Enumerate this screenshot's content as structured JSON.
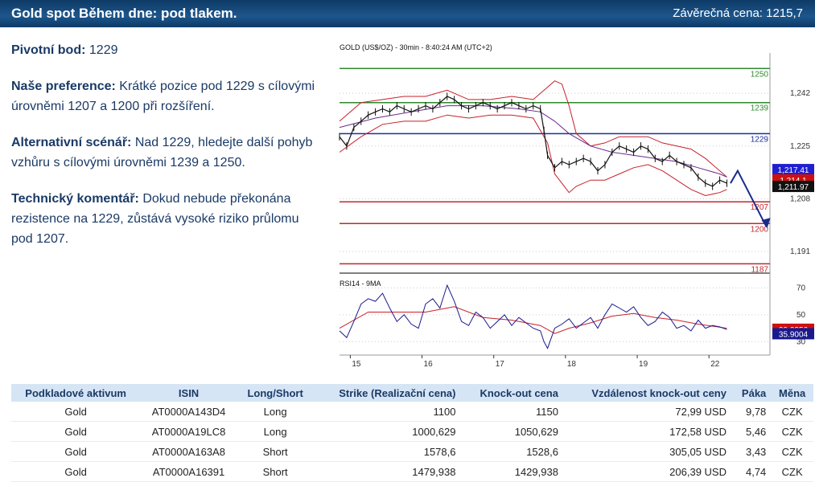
{
  "header": {
    "title": "Gold spot Během dne: pod tlakem.",
    "close_label": "Závěrečná cena: 1215,7"
  },
  "commentary": {
    "pivot_label": "Pivotní bod:",
    "pivot_value": "1229",
    "pref_label": "Naše preference:",
    "pref_text": "Krátké pozice pod 1229 s cílovými úrovněmi 1207 a 1200 při  rozšíření.",
    "alt_label": "Alternativní scénář:",
    "alt_text": "Nad 1229, hledejte další pohyb vzhůru s cílovými úrovněmi 1239 a 1250.",
    "tech_label": "Technický komentář:",
    "tech_text": "Dokud nebude překonána rezistence na 1229, zůstává vysoké riziko průlomu pod 1207."
  },
  "chart_data": {
    "type": "line",
    "title": "GOLD (US$/OZ) - 30min - 8:40:24 AM (UTC+2)",
    "rsi_title": "RSI14 - 9MA",
    "x_ticks": [
      "15",
      "16",
      "17",
      "18",
      "19",
      "22"
    ],
    "price_ylim": [
      1184,
      1255
    ],
    "price_ticks": [
      "1,242",
      "1,225",
      "1,208",
      "1,191"
    ],
    "price_tick_values": [
      1242,
      1225,
      1208,
      1191
    ],
    "levels": [
      {
        "value": 1250,
        "label": "1250",
        "color": "#2e8b2e"
      },
      {
        "value": 1239,
        "label": "1239",
        "color": "#2e8b2e"
      },
      {
        "value": 1229,
        "label": "1229",
        "color": "#1a2f9a"
      },
      {
        "value": 1207,
        "label": "1207",
        "color": "#c0282d"
      },
      {
        "value": 1200,
        "label": "1200",
        "color": "#c0282d"
      },
      {
        "value": 1187,
        "label": "1187",
        "color": "#c0282d"
      }
    ],
    "price_tags": [
      {
        "value": 1217.41,
        "label": "1,217.41",
        "color": "#1f1fd0"
      },
      {
        "value": 1214.1,
        "label": "1,214.1",
        "color": "#cc1010"
      },
      {
        "value": 1211.97,
        "label": "1,211.97",
        "color": "#111111"
      }
    ],
    "price_series": [
      [
        0,
        1228
      ],
      [
        2,
        1225
      ],
      [
        4,
        1231
      ],
      [
        6,
        1233
      ],
      [
        8,
        1235
      ],
      [
        10,
        1236
      ],
      [
        12,
        1237
      ],
      [
        14,
        1236
      ],
      [
        16,
        1238
      ],
      [
        18,
        1237
      ],
      [
        20,
        1236
      ],
      [
        22,
        1237
      ],
      [
        24,
        1238
      ],
      [
        26,
        1237
      ],
      [
        28,
        1239
      ],
      [
        30,
        1241
      ],
      [
        32,
        1240
      ],
      [
        34,
        1238
      ],
      [
        36,
        1237
      ],
      [
        38,
        1238
      ],
      [
        40,
        1239
      ],
      [
        42,
        1238
      ],
      [
        44,
        1237
      ],
      [
        46,
        1238
      ],
      [
        48,
        1239
      ],
      [
        50,
        1238
      ],
      [
        52,
        1237
      ],
      [
        54,
        1238
      ],
      [
        56,
        1237
      ],
      [
        57,
        1230
      ],
      [
        58,
        1222
      ],
      [
        60,
        1218
      ],
      [
        62,
        1220
      ],
      [
        64,
        1219
      ],
      [
        66,
        1220
      ],
      [
        68,
        1221
      ],
      [
        70,
        1220
      ],
      [
        72,
        1217
      ],
      [
        74,
        1219
      ],
      [
        76,
        1223
      ],
      [
        78,
        1225
      ],
      [
        80,
        1224
      ],
      [
        82,
        1223
      ],
      [
        84,
        1225
      ],
      [
        86,
        1224
      ],
      [
        88,
        1221
      ],
      [
        90,
        1220
      ],
      [
        92,
        1222
      ],
      [
        94,
        1220
      ],
      [
        96,
        1219
      ],
      [
        98,
        1218
      ],
      [
        100,
        1215
      ],
      [
        102,
        1213
      ],
      [
        104,
        1212
      ],
      [
        106,
        1214
      ],
      [
        108,
        1213
      ]
    ],
    "bb_upper": [
      [
        0,
        1233
      ],
      [
        6,
        1239
      ],
      [
        12,
        1240
      ],
      [
        18,
        1241
      ],
      [
        24,
        1241
      ],
      [
        30,
        1243
      ],
      [
        36,
        1240
      ],
      [
        42,
        1240
      ],
      [
        48,
        1241
      ],
      [
        54,
        1240
      ],
      [
        58,
        1244
      ],
      [
        60,
        1246
      ],
      [
        62,
        1245
      ],
      [
        64,
        1238
      ],
      [
        66,
        1229
      ],
      [
        70,
        1225
      ],
      [
        74,
        1226
      ],
      [
        78,
        1228
      ],
      [
        82,
        1228
      ],
      [
        86,
        1228
      ],
      [
        90,
        1226
      ],
      [
        94,
        1225
      ],
      [
        98,
        1224
      ],
      [
        102,
        1221
      ],
      [
        106,
        1217
      ],
      [
        108,
        1215
      ]
    ],
    "bb_lower": [
      [
        0,
        1223
      ],
      [
        6,
        1228
      ],
      [
        12,
        1232
      ],
      [
        18,
        1233
      ],
      [
        24,
        1233
      ],
      [
        30,
        1235
      ],
      [
        36,
        1234
      ],
      [
        42,
        1235
      ],
      [
        48,
        1235
      ],
      [
        54,
        1234
      ],
      [
        58,
        1226
      ],
      [
        60,
        1216
      ],
      [
        62,
        1213
      ],
      [
        64,
        1210
      ],
      [
        66,
        1212
      ],
      [
        70,
        1214
      ],
      [
        74,
        1214
      ],
      [
        78,
        1216
      ],
      [
        82,
        1218
      ],
      [
        86,
        1219
      ],
      [
        90,
        1217
      ],
      [
        94,
        1214
      ],
      [
        98,
        1211
      ],
      [
        102,
        1209
      ],
      [
        106,
        1210
      ],
      [
        108,
        1211
      ]
    ],
    "ma_line": [
      [
        0,
        1231
      ],
      [
        10,
        1234
      ],
      [
        20,
        1236
      ],
      [
        30,
        1238
      ],
      [
        40,
        1238
      ],
      [
        50,
        1237
      ],
      [
        56,
        1236
      ],
      [
        60,
        1233
      ],
      [
        64,
        1229
      ],
      [
        70,
        1225
      ],
      [
        76,
        1223
      ],
      [
        82,
        1222
      ],
      [
        88,
        1221
      ],
      [
        94,
        1220
      ],
      [
        100,
        1218
      ],
      [
        106,
        1216
      ],
      [
        108,
        1215
      ]
    ],
    "forecast_arrow": [
      [
        109,
        1213
      ],
      [
        111,
        1217
      ],
      [
        119,
        1199
      ]
    ],
    "rsi_ylim": [
      20,
      78
    ],
    "rsi_ticks": [
      "70",
      "50",
      "30"
    ],
    "rsi_tick_values": [
      70,
      50,
      30
    ],
    "rsi_series": [
      [
        0,
        38
      ],
      [
        2,
        33
      ],
      [
        4,
        45
      ],
      [
        6,
        58
      ],
      [
        8,
        62
      ],
      [
        10,
        60
      ],
      [
        12,
        66
      ],
      [
        14,
        55
      ],
      [
        16,
        45
      ],
      [
        18,
        50
      ],
      [
        20,
        43
      ],
      [
        22,
        40
      ],
      [
        24,
        58
      ],
      [
        26,
        62
      ],
      [
        28,
        55
      ],
      [
        30,
        72
      ],
      [
        32,
        60
      ],
      [
        34,
        45
      ],
      [
        36,
        42
      ],
      [
        38,
        52
      ],
      [
        40,
        48
      ],
      [
        42,
        40
      ],
      [
        44,
        45
      ],
      [
        46,
        50
      ],
      [
        48,
        42
      ],
      [
        50,
        48
      ],
      [
        52,
        44
      ],
      [
        54,
        40
      ],
      [
        56,
        38
      ],
      [
        57,
        30
      ],
      [
        58,
        25
      ],
      [
        60,
        40
      ],
      [
        62,
        43
      ],
      [
        64,
        47
      ],
      [
        66,
        40
      ],
      [
        68,
        44
      ],
      [
        70,
        48
      ],
      [
        72,
        40
      ],
      [
        74,
        50
      ],
      [
        76,
        58
      ],
      [
        78,
        55
      ],
      [
        80,
        52
      ],
      [
        82,
        56
      ],
      [
        84,
        48
      ],
      [
        86,
        42
      ],
      [
        88,
        45
      ],
      [
        90,
        52
      ],
      [
        92,
        48
      ],
      [
        94,
        40
      ],
      [
        96,
        42
      ],
      [
        98,
        38
      ],
      [
        100,
        46
      ],
      [
        102,
        40
      ],
      [
        104,
        42
      ],
      [
        106,
        41
      ],
      [
        108,
        39
      ]
    ],
    "rsi_ma": [
      [
        0,
        40
      ],
      [
        8,
        52
      ],
      [
        16,
        52
      ],
      [
        24,
        52
      ],
      [
        32,
        56
      ],
      [
        40,
        48
      ],
      [
        48,
        46
      ],
      [
        56,
        42
      ],
      [
        60,
        36
      ],
      [
        64,
        40
      ],
      [
        70,
        44
      ],
      [
        76,
        49
      ],
      [
        82,
        51
      ],
      [
        88,
        48
      ],
      [
        94,
        46
      ],
      [
        100,
        43
      ],
      [
        108,
        40
      ]
    ],
    "rsi_tags": [
      {
        "value": 39.2356,
        "label": "39.2356",
        "color": "#cc1010"
      },
      {
        "value": 35.9004,
        "label": "35.9004",
        "color": "#1a1a8c"
      }
    ]
  },
  "table": {
    "headers": [
      "Podkladové aktivum",
      "ISIN",
      "Long/Short",
      "Strike (Realizační cena)",
      "Knock-out cena",
      "Vzdálenost knock-out ceny",
      "Páka",
      "Měna"
    ],
    "rows": [
      [
        "Gold",
        "AT0000A143D4",
        "Long",
        "1100",
        "1150",
        "72,99 USD",
        "9,78",
        "CZK"
      ],
      [
        "Gold",
        "AT0000A19LC8",
        "Long",
        "1000,629",
        "1050,629",
        "172,58 USD",
        "5,46",
        "CZK"
      ],
      [
        "Gold",
        "AT0000A163A8",
        "Short",
        "1578,6",
        "1528,6",
        "305,05 USD",
        "3,43",
        "CZK"
      ],
      [
        "Gold",
        "AT0000A16391",
        "Short",
        "1479,938",
        "1429,938",
        "206,39 USD",
        "4,74",
        "CZK"
      ]
    ]
  }
}
